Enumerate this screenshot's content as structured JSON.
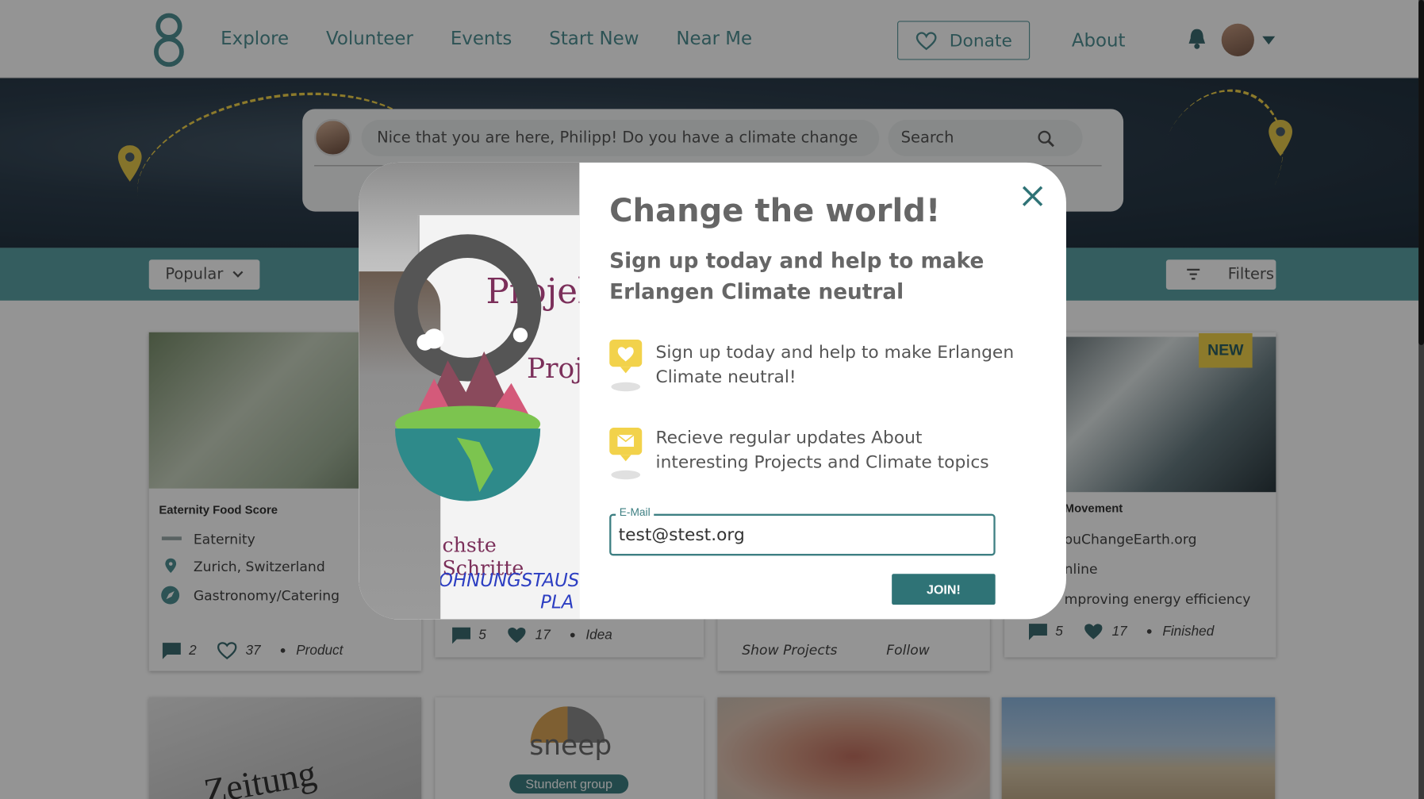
{
  "header": {
    "nav": [
      "Explore",
      "Volunteer",
      "Events",
      "Start New",
      "Near Me"
    ],
    "donate_label": "Donate",
    "about_label": "About"
  },
  "hero": {
    "post_placeholder": "Nice that you are here, Philipp! Do you have a climate change project?",
    "search_placeholder": "Search"
  },
  "filterbar": {
    "sort_label": "Popular",
    "filters_label": "Filters"
  },
  "cards": [
    {
      "title": "Eaternity Food Score",
      "org": "Eaternity",
      "location": "Zurich, Switzerland",
      "category": "Gastronomy/Catering",
      "comments": "2",
      "likes": "37",
      "type": "Product"
    },
    {
      "comments": "5",
      "likes": "17",
      "type": "Idea"
    },
    {
      "action1": "Show Projects",
      "action2": "Follow"
    },
    {
      "title": "Movement",
      "org": "ouChangeEarth.org",
      "location": "nline",
      "category": "mproving energy efficiency",
      "comments": "5",
      "likes": "17",
      "type": "Finished",
      "badge": "NEW"
    }
  ],
  "row2": {
    "sneep_logo": "sneep",
    "student_badge": "Stundent group",
    "newspaper_text": "Zeitung"
  },
  "modal": {
    "title": "Change the world!",
    "subtitle": "Sign up today and help to make Erlangen Climate neutral",
    "features": [
      {
        "icon": "heart-icon",
        "text": "Sign up today and help to make Erlangen Climate neutral!"
      },
      {
        "icon": "mail-icon",
        "text": "Recieve regular updates About interesting Projects and Climate topics"
      }
    ],
    "email_label": "E-Mail",
    "email_value": "test@stest.org",
    "join_label": "JOIN!",
    "flipchart_words": [
      "Projek",
      "Proje",
      "chste Schritte",
      "OHNUNGSTAUSC",
      "PLA"
    ]
  },
  "colors": {
    "teal": "#5aa1a4",
    "dark_teal": "#2f7376",
    "yellow": "#f2d24b"
  }
}
